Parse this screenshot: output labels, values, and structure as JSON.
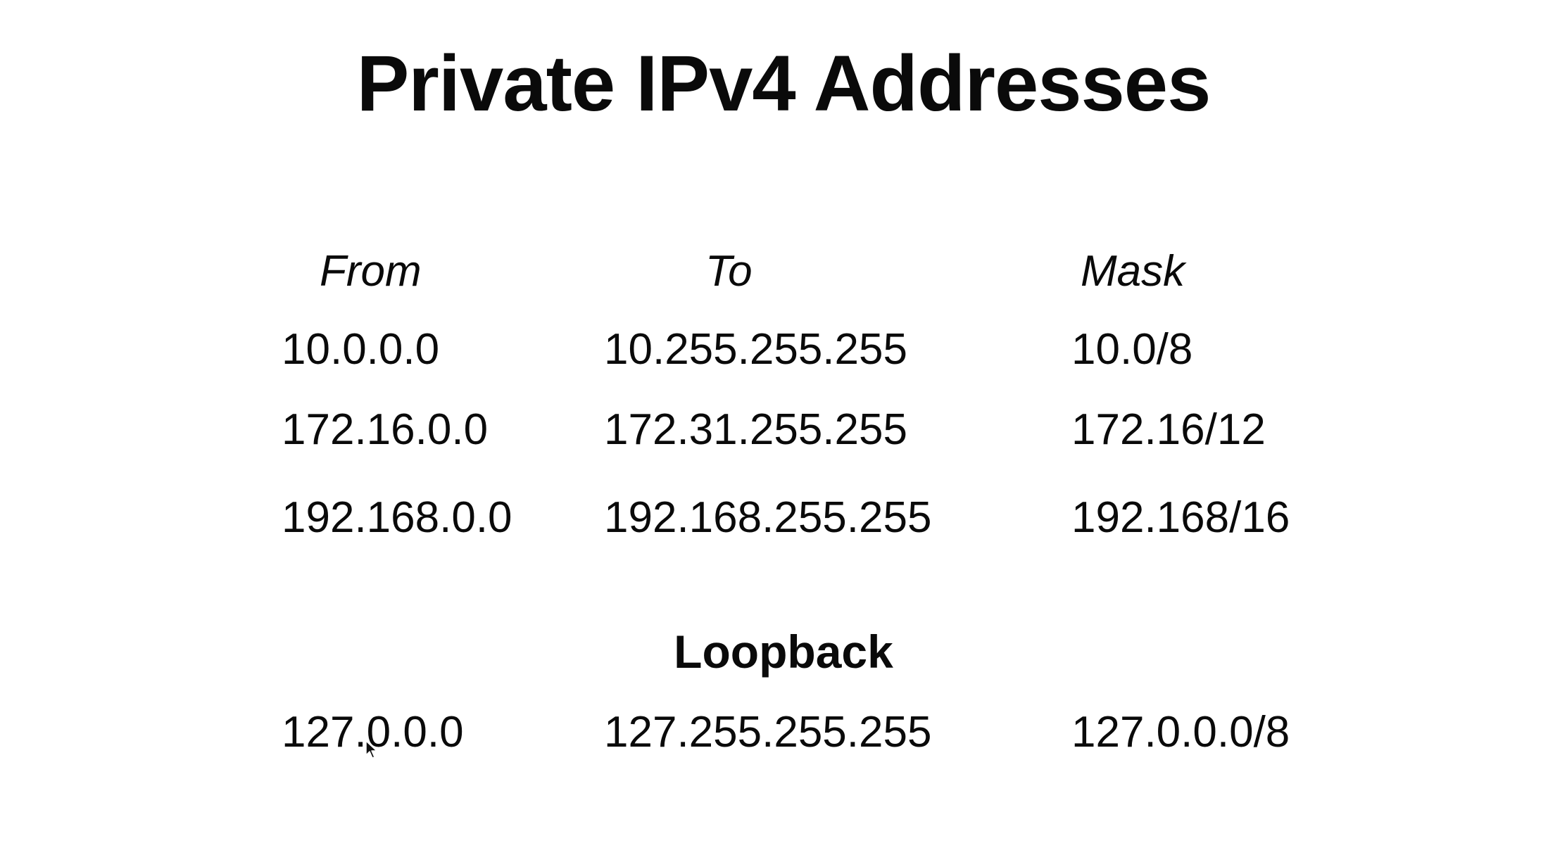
{
  "title": "Private IPv4 Addresses",
  "table": {
    "headers": [
      "From",
      "To",
      "Mask"
    ],
    "rows": [
      [
        "10.0.0.0",
        "10.255.255.255",
        "10.0/8"
      ],
      [
        "172.16.0.0",
        "172.31.255.255",
        "172.16/12"
      ],
      [
        "192.168.0.0",
        "192.168.255.255",
        "192.168/16"
      ]
    ]
  },
  "loopback": {
    "heading": "Loopback",
    "row": [
      "127.0.0.0",
      "127.255.255.255",
      "127.0.0.0/8"
    ]
  },
  "icons": {
    "cursor": "mouse-pointer-icon"
  }
}
